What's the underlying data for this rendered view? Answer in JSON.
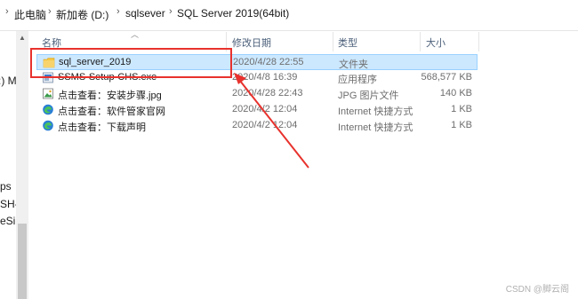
{
  "address_bar": {
    "crumbs": [
      "此电脑",
      "新加卷 (D:)",
      "sqlsever",
      "SQL Server 2019(64bit)"
    ],
    "separator": "›"
  },
  "nav_pane": {
    "fragments": [
      ":) M",
      "ps",
      "SH-r",
      "eSin"
    ]
  },
  "columns": {
    "name": "名称",
    "date": "修改日期",
    "type": "类型",
    "size": "大小"
  },
  "files": [
    {
      "name": "sql_server_2019",
      "date": "2020/4/28 22:55",
      "type": "文件夹",
      "size": "",
      "icon": "folder-icon",
      "selected": true
    },
    {
      "name": "SSMS-Setup-CHS.exe",
      "date": "2020/4/8 16:39",
      "type": "应用程序",
      "size": "568,577 KB",
      "icon": "installer-icon",
      "selected": false
    },
    {
      "name": "点击查看：安装步骤.jpg",
      "date": "2020/4/28 22:43",
      "type": "JPG 图片文件",
      "size": "140 KB",
      "icon": "image-file-icon",
      "selected": false
    },
    {
      "name": "点击查看：软件管家官网",
      "date": "2020/4/2 12:04",
      "type": "Internet 快捷方式",
      "size": "1 KB",
      "icon": "edge-shortcut-icon",
      "selected": false
    },
    {
      "name": "点击查看：下载声明",
      "date": "2020/4/2 12:04",
      "type": "Internet 快捷方式",
      "size": "1 KB",
      "icon": "edge-shortcut-icon",
      "selected": false
    }
  ],
  "colors": {
    "annotation": "#e8322d",
    "selection_bg": "#cce8ff",
    "selection_border": "#99d1ff",
    "folder": "#f4c542"
  },
  "watermark": "CSDN @脚云阁"
}
